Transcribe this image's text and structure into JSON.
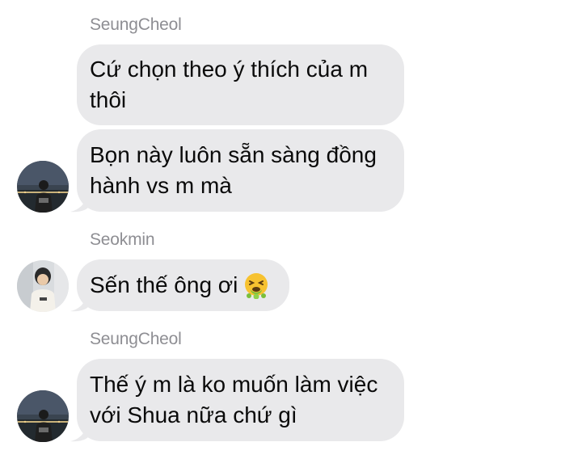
{
  "messages": [
    {
      "sender": "SeungCheol",
      "bubbles": [
        "Cứ chọn theo ý thích của m thôi",
        "Bọn này luôn sẵn sàng đồng hành vs m mà"
      ]
    },
    {
      "sender": "Seokmin",
      "bubbles": [
        "Sến thế ông ơi"
      ],
      "emoji": "face-vomiting-emoji"
    },
    {
      "sender": "SeungCheol",
      "bubbles": [
        "Thế ý m là ko muốn làm việc với Shua nữa chứ gì"
      ]
    }
  ],
  "colors": {
    "bubble_background": "#e9e9eb",
    "sender_name": "#8e8e93",
    "message_text": "#0a0a0a"
  }
}
